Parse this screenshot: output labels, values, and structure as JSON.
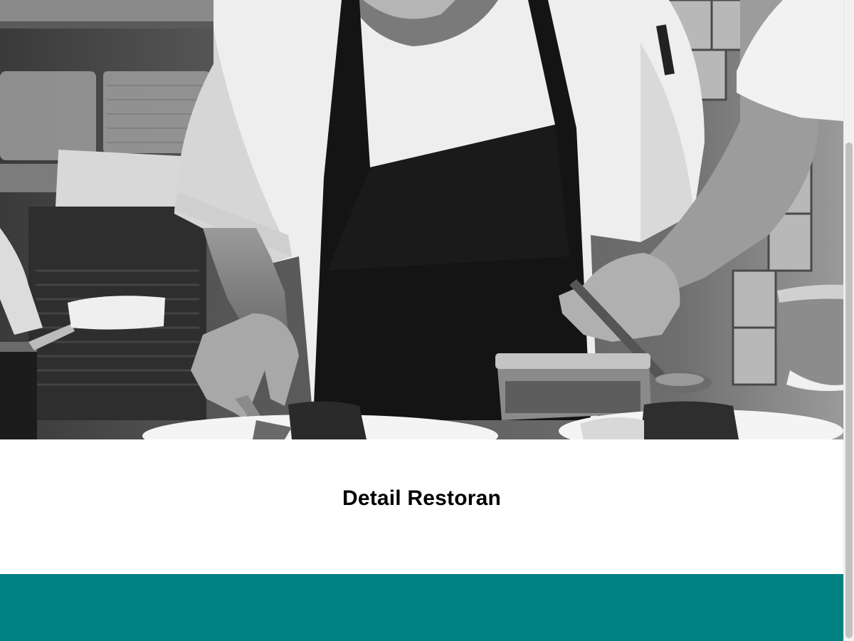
{
  "hero": {
    "image_icon": "chef-plating-photo-icon"
  },
  "main": {
    "title": "Detail Restoran"
  },
  "colors": {
    "footer_background": "#008080",
    "page_background": "#ffffff",
    "scrollbar_track": "#f1f1f1",
    "scrollbar_thumb": "#c1c1c1"
  }
}
